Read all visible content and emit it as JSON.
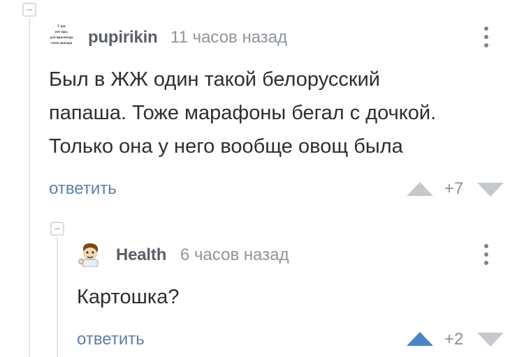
{
  "colors": {
    "vote_up_active": "#4a86c5",
    "vote_neutral": "#c5c9ce",
    "link": "#5e7fa6"
  },
  "comments": [
    {
      "username": "pupirikin",
      "timestamp": "11 часов назад",
      "text_lines": [
        "Был в ЖЖ один такой белорусский",
        "папаша. Тоже марафоны бегал с дочкой.",
        "Только она у него вообще овощ была"
      ],
      "reply_label": "ответить",
      "rating": "+7",
      "avatar_icon": "text-meme-avatar-icon",
      "avatar_text": [
        "У нас",
        "нет пра.",
        "для просмотра",
        "этого аватара"
      ]
    },
    {
      "username": "Health",
      "timestamp": "6 часов назад",
      "text_lines": [
        "Картошка?"
      ],
      "reply_label": "ответить",
      "rating": "+2",
      "avatar_icon": "cartoon-character-avatar-icon",
      "upvote_active": true
    }
  ]
}
